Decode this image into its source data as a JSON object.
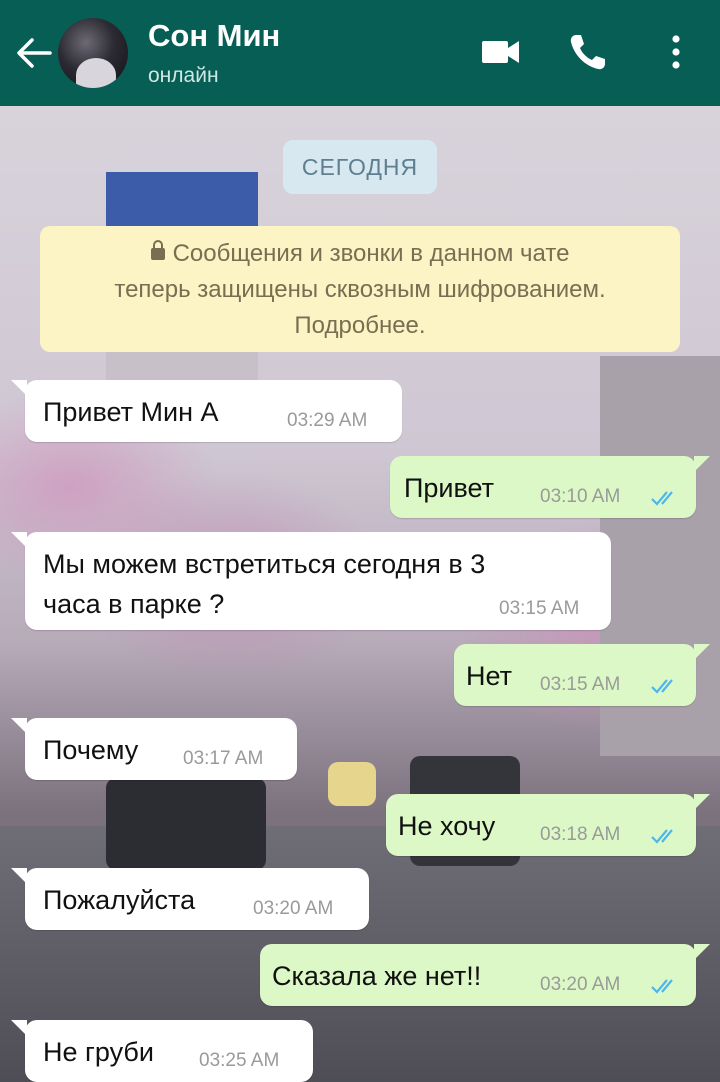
{
  "header": {
    "contact_name": "Сон Мин",
    "status": "онлайн",
    "colors": {
      "bar": "#075e54",
      "icon": "#ffffff"
    },
    "icons": [
      "back-arrow-icon",
      "avatar",
      "video-call-icon",
      "phone-icon",
      "more-menu-icon"
    ]
  },
  "chat": {
    "date_chip": "СЕГОДНЯ",
    "encryption": {
      "line1": "Сообщения и звонки в данном чате",
      "line2": "теперь защищены сквозным шифрованием.",
      "line3": "Подробнее."
    },
    "messages": [
      {
        "direction": "in",
        "text": "Привет Мин А",
        "time": "03:29 AM"
      },
      {
        "direction": "out",
        "text": "Привет",
        "time": "03:10 AM",
        "read": true
      },
      {
        "direction": "in",
        "text_line1": "Мы можем встретиться сегодня в 3",
        "text_line2": "часа в парке ?",
        "time": "03:15 AM"
      },
      {
        "direction": "out",
        "text": "Нет",
        "time": "03:15 AM",
        "read": true
      },
      {
        "direction": "in",
        "text": "Почему",
        "time": "03:17 AM"
      },
      {
        "direction": "out",
        "text": "Не хочу",
        "time": "03:18 AM",
        "read": true
      },
      {
        "direction": "in",
        "text": "Пожалуйста",
        "time": "03:20 AM"
      },
      {
        "direction": "out",
        "text": "Сказала же нет!!",
        "time": "03:20 AM",
        "read": true
      },
      {
        "direction": "in",
        "text": "Не груби",
        "time": "03:25 AM"
      }
    ],
    "colors": {
      "incoming": "#ffffff",
      "outgoing": "#dcf8c6",
      "read_ticks": "#4fb6ec"
    }
  }
}
